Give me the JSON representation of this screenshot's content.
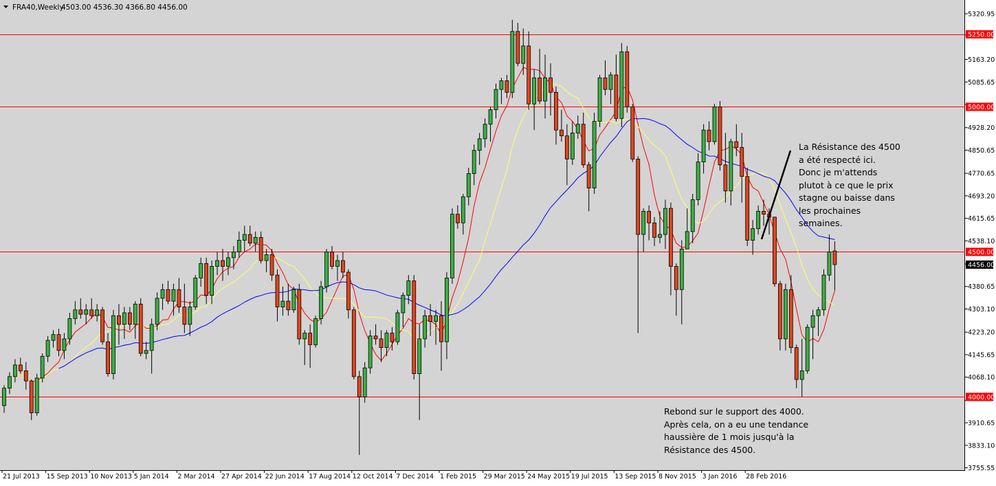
{
  "header": {
    "symbol": "FRA40,Weekly",
    "ohlc": "4503.00 4536.30 4366.80 4456.00"
  },
  "colors": {
    "background": "#d4d4d4",
    "bull_candle": "#3cb043",
    "bear_candle": "#e0451c",
    "candle_outline": "#000000",
    "level_line": "#ff0000",
    "level_tag": "#ff0000",
    "price_tag": "#000000",
    "ma_fast": "#ff0000",
    "ma_mid": "#ffff66",
    "ma_slow": "#0000ff"
  },
  "annotations": {
    "resistance_note": "La Résistance des 4500\na été respecté ici.\nDonc je m'attends\nplutot à ce que le prix\nstagne ou baisse dans\nles prochaines\nsemaines.",
    "support_note": "Rebond sur le support des 4000.\nAprès cela, on a eu une tendance\nhaussière de 1 mois jusqu'à la\nRésistance des 4500."
  },
  "chart_data": {
    "type": "candlestick",
    "title": "FRA40,Weekly",
    "timeframe": "Weekly",
    "ylim": [
      3755.55,
      5320.95
    ],
    "y_ticks": [
      "5320.95",
      "5247.85",
      "5163.20",
      "5085.65",
      "5008.10",
      "4928.20",
      "4850.65",
      "4770.65",
      "4693.20",
      "4615.65",
      "4538.10",
      "4458.10",
      "4380.65",
      "4303.10",
      "4223.20",
      "4145.65",
      "4068.10",
      "3988.10",
      "3910.65",
      "3833.10",
      "3755.55"
    ],
    "hidden_ticks": [
      "5247.85",
      "5008.10",
      "4458.10",
      "3988.10"
    ],
    "x_ticks": [
      {
        "label": "21 Jul 2013",
        "index": 0
      },
      {
        "label": "15 Sep 2013",
        "index": 8
      },
      {
        "label": "10 Nov 2013",
        "index": 16
      },
      {
        "label": "5 Jan 2014",
        "index": 24
      },
      {
        "label": "2 Mar 2014",
        "index": 32
      },
      {
        "label": "27 Apr 2014",
        "index": 40
      },
      {
        "label": "22 Jun 2014",
        "index": 48
      },
      {
        "label": "17 Aug 2014",
        "index": 56
      },
      {
        "label": "12 Oct 2014",
        "index": 64
      },
      {
        "label": "7 Dec 2014",
        "index": 72
      },
      {
        "label": "1 Feb 2015",
        "index": 80
      },
      {
        "label": "29 Mar 2015",
        "index": 88
      },
      {
        "label": "24 May 2015",
        "index": 96
      },
      {
        "label": "19 Jul 2015",
        "index": 104
      },
      {
        "label": "13 Sep 2015",
        "index": 112
      },
      {
        "label": "8 Nov 2015",
        "index": 120
      },
      {
        "label": "3 Jan 2016",
        "index": 128
      },
      {
        "label": "28 Feb 2016",
        "index": 136
      }
    ],
    "levels": [
      {
        "value": 5250.0,
        "label": "5250.00"
      },
      {
        "value": 5000.0,
        "label": "5000.00"
      },
      {
        "value": 4500.0,
        "label": "4500.00"
      },
      {
        "value": 4000.0,
        "label": "4000.00"
      }
    ],
    "current_price": {
      "value": 4456.0,
      "label": "4456.00"
    },
    "candles": [
      [
        3970,
        4040,
        3945,
        4030
      ],
      [
        4030,
        4085,
        4010,
        4070
      ],
      [
        4070,
        4130,
        4050,
        4110
      ],
      [
        4110,
        4135,
        4080,
        4090
      ],
      [
        4090,
        4120,
        4025,
        4055
      ],
      [
        4055,
        4060,
        3920,
        3945
      ],
      [
        3945,
        4080,
        3935,
        4065
      ],
      [
        4065,
        4150,
        4050,
        4140
      ],
      [
        4140,
        4210,
        4120,
        4195
      ],
      [
        4195,
        4230,
        4170,
        4215
      ],
      [
        4215,
        4235,
        4140,
        4160
      ],
      [
        4160,
        4220,
        4130,
        4200
      ],
      [
        4200,
        4290,
        4180,
        4270
      ],
      [
        4270,
        4330,
        4250,
        4300
      ],
      [
        4300,
        4340,
        4270,
        4285
      ],
      [
        4285,
        4320,
        4250,
        4300
      ],
      [
        4300,
        4340,
        4270,
        4280
      ],
      [
        4280,
        4320,
        4260,
        4300
      ],
      [
        4300,
        4310,
        4180,
        4190
      ],
      [
        4190,
        4220,
        4070,
        4080
      ],
      [
        4080,
        4300,
        4060,
        4280
      ],
      [
        4280,
        4320,
        4180,
        4250
      ],
      [
        4250,
        4310,
        4200,
        4290
      ],
      [
        4290,
        4310,
        4230,
        4250
      ],
      [
        4250,
        4330,
        4200,
        4320
      ],
      [
        4320,
        4340,
        4140,
        4150
      ],
      [
        4150,
        4190,
        4130,
        4160
      ],
      [
        4160,
        4270,
        4080,
        4250
      ],
      [
        4250,
        4360,
        4230,
        4340
      ],
      [
        4340,
        4390,
        4300,
        4370
      ],
      [
        4370,
        4400,
        4320,
        4330
      ],
      [
        4330,
        4390,
        4280,
        4370
      ],
      [
        4370,
        4410,
        4290,
        4310
      ],
      [
        4310,
        4390,
        4220,
        4250
      ],
      [
        4250,
        4330,
        4210,
        4310
      ],
      [
        4310,
        4420,
        4300,
        4410
      ],
      [
        4410,
        4480,
        4380,
        4460
      ],
      [
        4460,
        4480,
        4320,
        4350
      ],
      [
        4350,
        4470,
        4320,
        4450
      ],
      [
        4450,
        4500,
        4420,
        4470
      ],
      [
        4470,
        4510,
        4400,
        4450
      ],
      [
        4450,
        4500,
        4420,
        4480
      ],
      [
        4480,
        4520,
        4440,
        4500
      ],
      [
        4500,
        4570,
        4480,
        4540
      ],
      [
        4540,
        4590,
        4500,
        4560
      ],
      [
        4560,
        4590,
        4520,
        4530
      ],
      [
        4530,
        4570,
        4500,
        4550
      ],
      [
        4550,
        4570,
        4460,
        4470
      ],
      [
        4470,
        4510,
        4430,
        4490
      ],
      [
        4490,
        4510,
        4400,
        4420
      ],
      [
        4420,
        4440,
        4260,
        4310
      ],
      [
        4310,
        4380,
        4280,
        4330
      ],
      [
        4330,
        4390,
        4280,
        4300
      ],
      [
        4300,
        4380,
        4290,
        4370
      ],
      [
        4370,
        4390,
        4180,
        4200
      ],
      [
        4200,
        4230,
        4110,
        4220
      ],
      [
        4220,
        4250,
        4100,
        4180
      ],
      [
        4180,
        4280,
        4170,
        4270
      ],
      [
        4270,
        4400,
        4250,
        4380
      ],
      [
        4380,
        4510,
        4360,
        4500
      ],
      [
        4500,
        4520,
        4440,
        4450
      ],
      [
        4450,
        4490,
        4400,
        4470
      ],
      [
        4470,
        4500,
        4410,
        4430
      ],
      [
        4430,
        4440,
        4270,
        4300
      ],
      [
        4300,
        4310,
        4060,
        4070
      ],
      [
        4070,
        4090,
        3800,
        4000
      ],
      [
        4000,
        4120,
        3980,
        4100
      ],
      [
        4100,
        4230,
        4080,
        4210
      ],
      [
        4210,
        4250,
        4180,
        4200
      ],
      [
        4200,
        4230,
        4120,
        4170
      ],
      [
        4170,
        4230,
        4140,
        4220
      ],
      [
        4220,
        4240,
        4160,
        4190
      ],
      [
        4190,
        4300,
        4180,
        4290
      ],
      [
        4290,
        4360,
        4240,
        4350
      ],
      [
        4350,
        4420,
        4320,
        4400
      ],
      [
        4400,
        4420,
        4060,
        4080
      ],
      [
        4080,
        4250,
        3920,
        4200
      ],
      [
        4200,
        4300,
        4170,
        4280
      ],
      [
        4280,
        4320,
        4210,
        4260
      ],
      [
        4260,
        4300,
        4180,
        4280
      ],
      [
        4280,
        4330,
        4090,
        4190
      ],
      [
        4190,
        4430,
        4130,
        4410
      ],
      [
        4410,
        4650,
        4390,
        4630
      ],
      [
        4630,
        4660,
        4580,
        4600
      ],
      [
        4600,
        4700,
        4560,
        4690
      ],
      [
        4690,
        4790,
        4660,
        4770
      ],
      [
        4770,
        4870,
        4730,
        4850
      ],
      [
        4850,
        4910,
        4800,
        4890
      ],
      [
        4890,
        4960,
        4860,
        4940
      ],
      [
        4940,
        5000,
        4880,
        4990
      ],
      [
        4990,
        5080,
        4960,
        5060
      ],
      [
        5060,
        5100,
        5010,
        5090
      ],
      [
        5090,
        5110,
        5030,
        5050
      ],
      [
        5050,
        5300,
        5030,
        5260
      ],
      [
        5260,
        5290,
        5140,
        5150
      ],
      [
        5150,
        5270,
        5110,
        5210
      ],
      [
        5210,
        5260,
        4990,
        5010
      ],
      [
        5010,
        5130,
        4920,
        5100
      ],
      [
        5100,
        5200,
        5010,
        5020
      ],
      [
        5020,
        5180,
        4960,
        5100
      ],
      [
        5100,
        5150,
        4970,
        5050
      ],
      [
        5050,
        5070,
        4870,
        4920
      ],
      [
        4920,
        4990,
        4880,
        4900
      ],
      [
        4900,
        4940,
        4730,
        4820
      ],
      [
        4820,
        4950,
        4800,
        4910
      ],
      [
        4910,
        4970,
        4890,
        4940
      ],
      [
        4940,
        4980,
        4790,
        4800
      ],
      [
        4800,
        4810,
        4640,
        4720
      ],
      [
        4720,
        4980,
        4700,
        4950
      ],
      [
        4950,
        5110,
        4930,
        5100
      ],
      [
        5100,
        5160,
        5040,
        5060
      ],
      [
        5060,
        5120,
        5010,
        5110
      ],
      [
        5110,
        5180,
        4950,
        4960
      ],
      [
        4960,
        5220,
        4930,
        5190
      ],
      [
        5190,
        5210,
        4980,
        5000
      ],
      [
        5000,
        5010,
        4810,
        4820
      ],
      [
        4820,
        4830,
        4220,
        4560
      ],
      [
        4560,
        4650,
        4500,
        4640
      ],
      [
        4640,
        4660,
        4540,
        4600
      ],
      [
        4600,
        4620,
        4520,
        4550
      ],
      [
        4550,
        4640,
        4530,
        4560
      ],
      [
        4560,
        4680,
        4510,
        4650
      ],
      [
        4650,
        4670,
        4350,
        4450
      ],
      [
        4450,
        4460,
        4280,
        4370
      ],
      [
        4370,
        4540,
        4250,
        4510
      ],
      [
        4510,
        4650,
        4510,
        4570
      ],
      [
        4570,
        4700,
        4530,
        4680
      ],
      [
        4680,
        4840,
        4660,
        4810
      ],
      [
        4810,
        4940,
        4770,
        4920
      ],
      [
        4920,
        4950,
        4850,
        4880
      ],
      [
        4880,
        5010,
        4870,
        5000
      ],
      [
        5000,
        5020,
        4780,
        4800
      ],
      [
        4800,
        4910,
        4670,
        4710
      ],
      [
        4710,
        4890,
        4660,
        4880
      ],
      [
        4880,
        4940,
        4830,
        4860
      ],
      [
        4860,
        4910,
        4670,
        4760
      ],
      [
        4760,
        4790,
        4520,
        4540
      ],
      [
        4540,
        4610,
        4490,
        4580
      ],
      [
        4580,
        4660,
        4560,
        4640
      ],
      [
        4640,
        4680,
        4590,
        4630
      ],
      [
        4630,
        4650,
        4560,
        4620
      ],
      [
        4620,
        4620,
        4380,
        4390
      ],
      [
        4390,
        4400,
        4160,
        4200
      ],
      [
        4200,
        4390,
        4160,
        4370
      ],
      [
        4370,
        4420,
        4150,
        4170
      ],
      [
        4170,
        4180,
        4030,
        4060
      ],
      [
        4060,
        4200,
        4000,
        4090
      ],
      [
        4090,
        4250,
        4080,
        4240
      ],
      [
        4240,
        4300,
        4130,
        4280
      ],
      [
        4280,
        4310,
        4210,
        4300
      ],
      [
        4300,
        4440,
        4280,
        4420
      ],
      [
        4420,
        4560,
        4400,
        4500
      ],
      [
        4503,
        4536.3,
        4366.8,
        4456
      ]
    ]
  }
}
